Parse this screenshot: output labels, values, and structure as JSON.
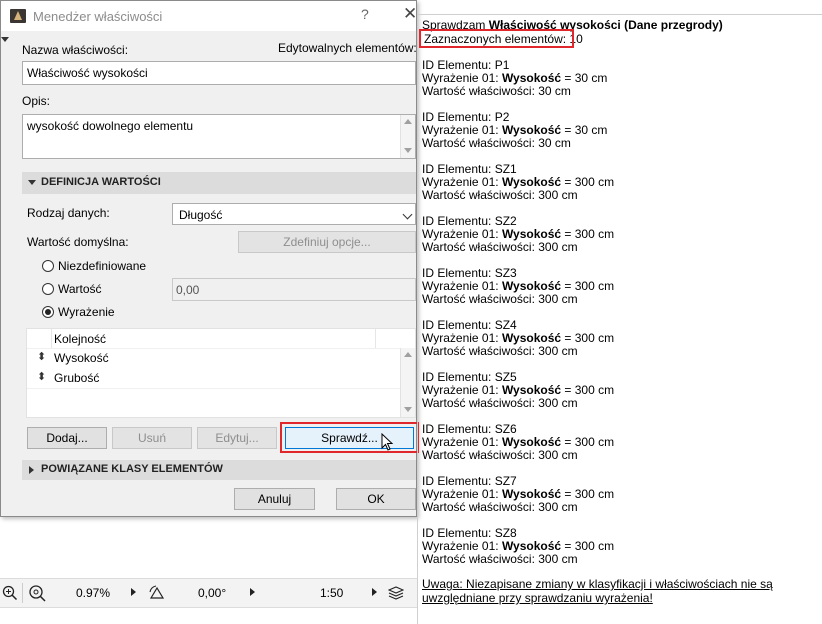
{
  "dialog": {
    "title": "Menedżer właściwości",
    "help": "?",
    "close": "✕",
    "name_label": "Nazwa właściwości:",
    "editable_label": "Edytowalnych elementów:",
    "name_value": "Właściwość wysokości",
    "desc_label": "Opis:",
    "desc_value": "wysokość dowolnego elementu",
    "value_def_header": "DEFINICJA WARTOŚCI",
    "data_type_label": "Rodzaj danych:",
    "data_type_value": "Długość",
    "default_label": "Wartość domyślna:",
    "define_options_btn": "Zdefiniuj opcje...",
    "radio_undefined": "Niezdefiniowane",
    "radio_value": "Wartość",
    "value_field": "0,00",
    "radio_expression": "Wyrażenie",
    "selected_radio": "expression",
    "list_header": "Kolejność",
    "list_items": [
      "Wysokość",
      "Grubość"
    ],
    "btn_add": "Dodaj...",
    "btn_remove": "Usuń",
    "btn_edit": "Edytuj...",
    "btn_check": "Sprawdź...",
    "related_header": "POWIĄZANE KLASY ELEMENTÓW",
    "btn_cancel": "Anuluj",
    "btn_ok": "OK"
  },
  "report": {
    "title_prefix": "Sprawdzam ",
    "title_bold": "Właściwość wysokości (Dane przegrody)",
    "selected_count": "Zaznaczonych elementów: 10",
    "expr_prefix": "Wyrażenie 01: ",
    "expr_bold": "Wysokość",
    "elements": [
      {
        "id": "ID Elementu: P1",
        "expr_val": " = 30 cm",
        "value": "Wartość właściwości: 30 cm"
      },
      {
        "id": "ID Elementu: P2",
        "expr_val": " = 30 cm",
        "value": "Wartość właściwości: 30 cm"
      },
      {
        "id": "ID Elementu: SZ1",
        "expr_val": " = 300 cm",
        "value": "Wartość właściwości: 300 cm"
      },
      {
        "id": "ID Elementu: SZ2",
        "expr_val": " = 300 cm",
        "value": "Wartość właściwości: 300 cm"
      },
      {
        "id": "ID Elementu: SZ3",
        "expr_val": " = 300 cm",
        "value": "Wartość właściwości: 300 cm"
      },
      {
        "id": "ID Elementu: SZ4",
        "expr_val": " = 300 cm",
        "value": "Wartość właściwości: 300 cm"
      },
      {
        "id": "ID Elementu: SZ5",
        "expr_val": " = 300 cm",
        "value": "Wartość właściwości: 300 cm"
      },
      {
        "id": "ID Elementu: SZ6",
        "expr_val": " = 300 cm",
        "value": "Wartość właściwości: 300 cm"
      },
      {
        "id": "ID Elementu: SZ7",
        "expr_val": " = 300 cm",
        "value": "Wartość właściwości: 300 cm"
      },
      {
        "id": "ID Elementu: SZ8",
        "expr_val": " = 300 cm",
        "value": "Wartość właściwości: 300 cm"
      }
    ],
    "note_line1": "Uwaga: Niezapisane zmiany w klasyfikacji i właściwościach nie są",
    "note_line2": "uwzględniane przy sprawdzaniu wyrażenia!"
  },
  "statusbar": {
    "zoom": "0.97%",
    "angle": "0,00°",
    "scale": "1:50"
  },
  "colors": {
    "highlight": "#e0272c"
  }
}
